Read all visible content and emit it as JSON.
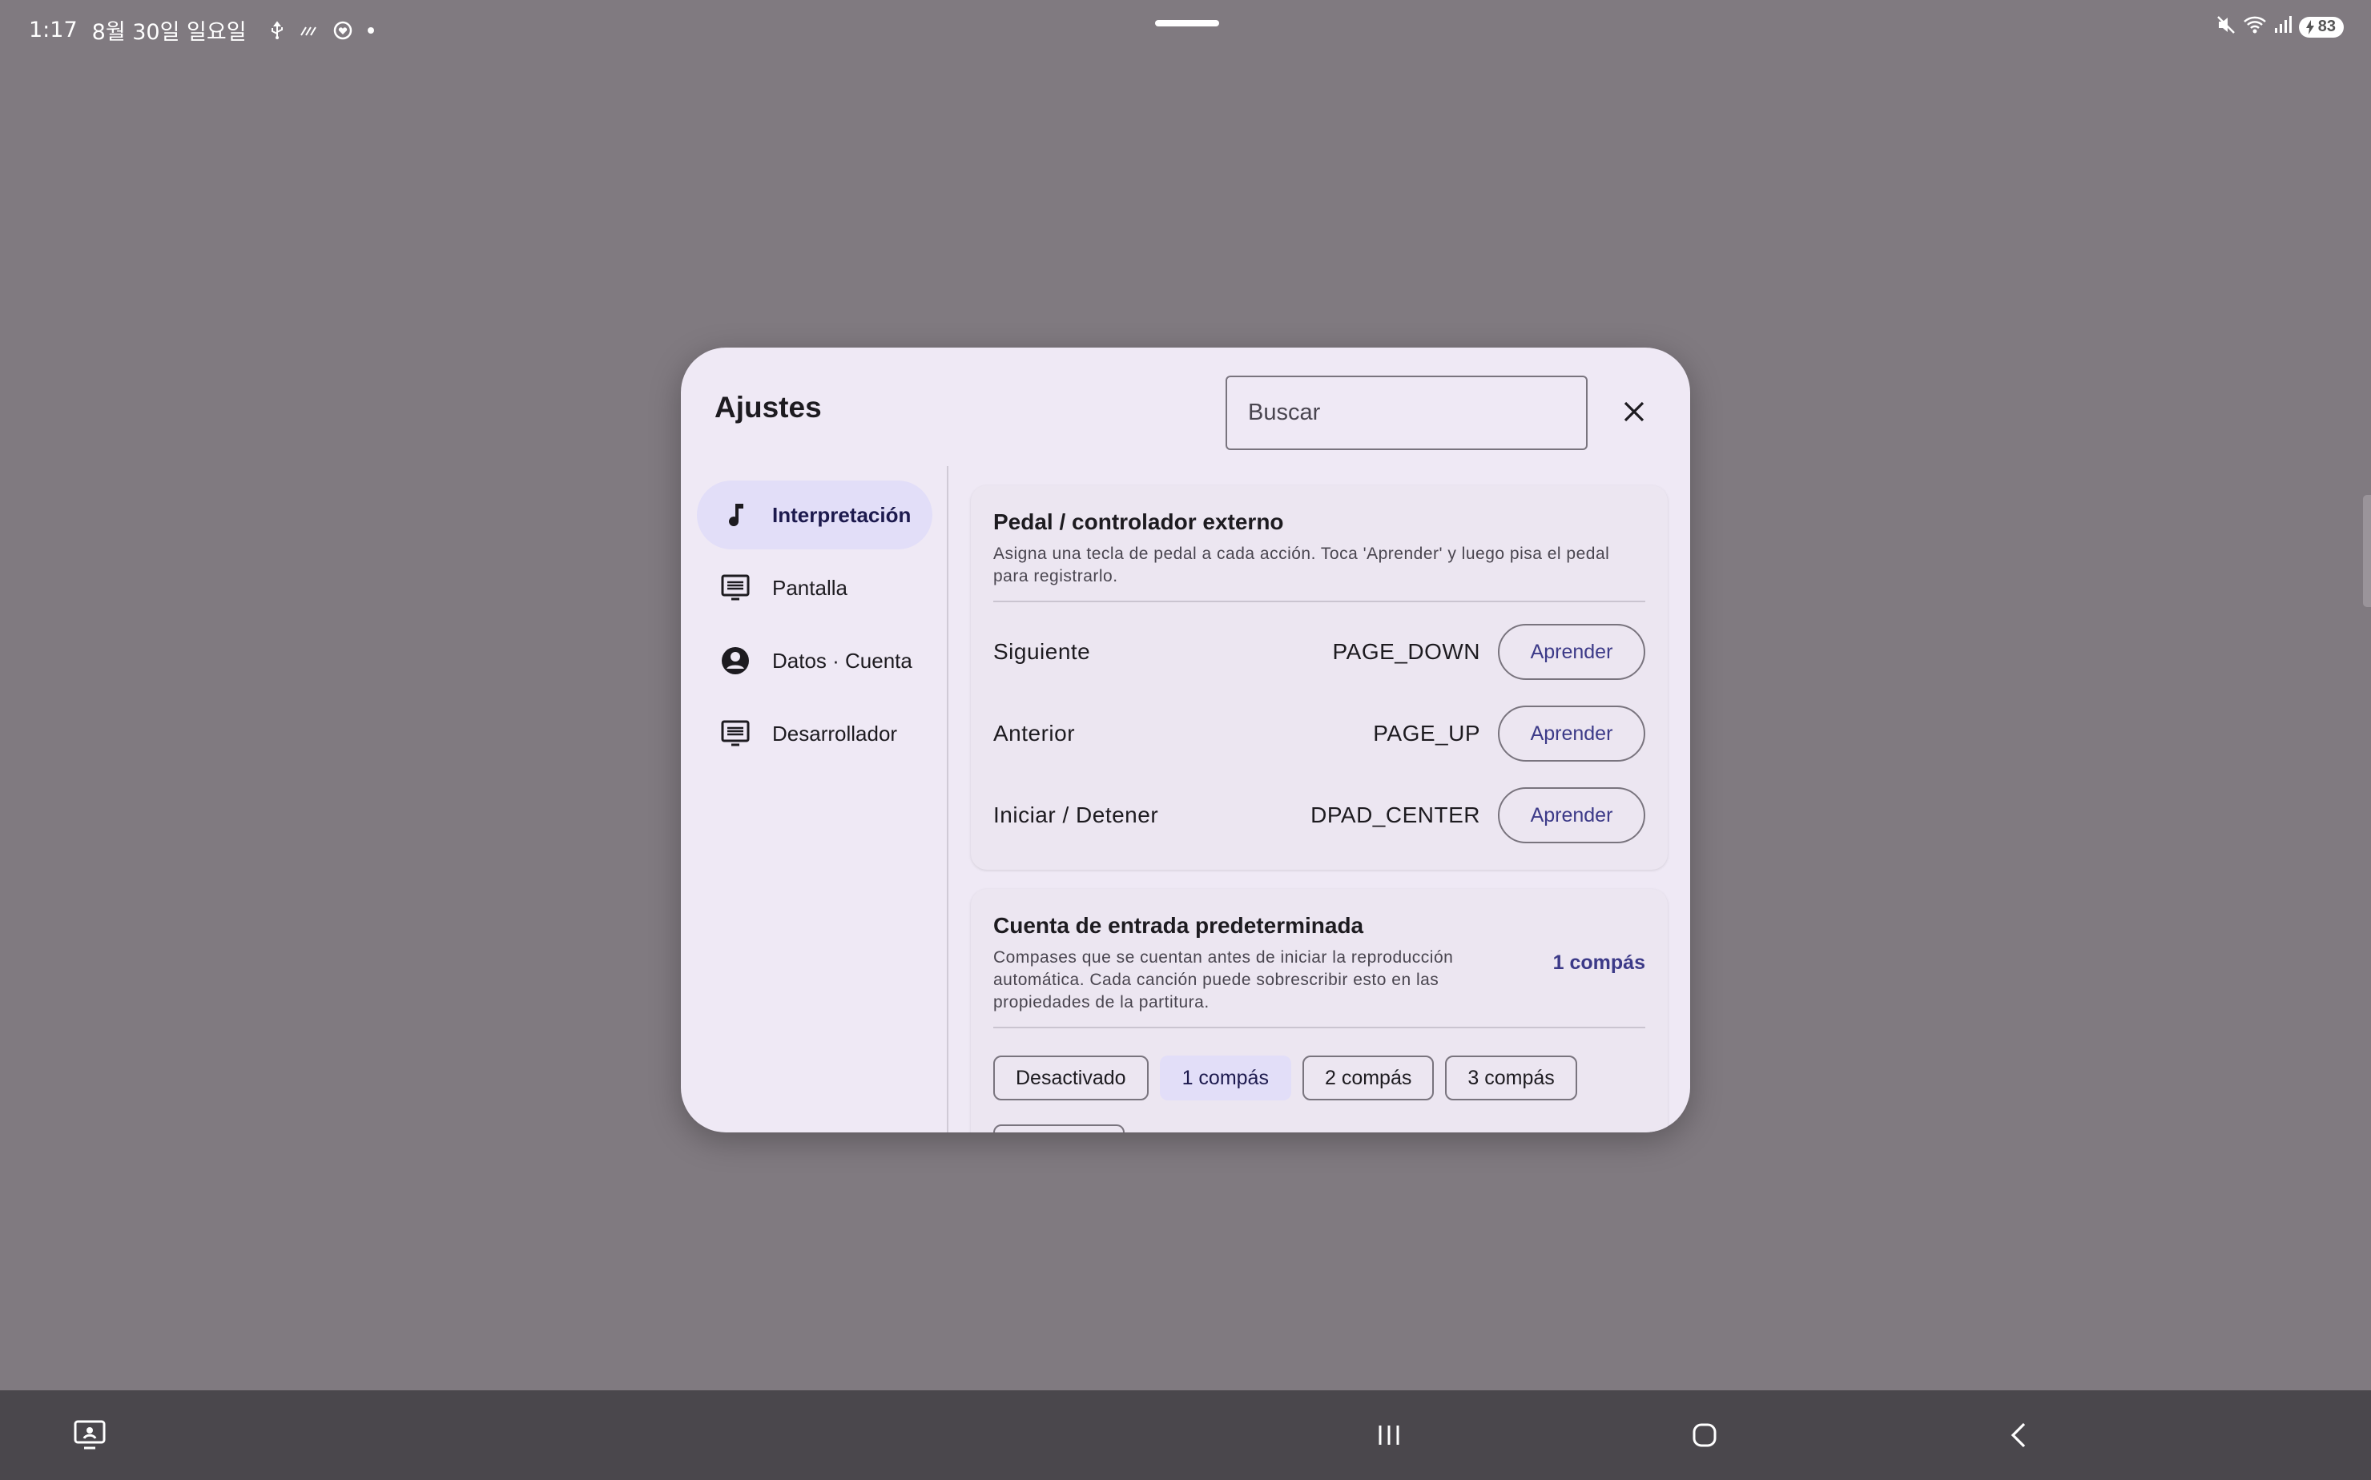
{
  "status_bar": {
    "time": "1:17",
    "date": "8월 30일 일요일",
    "battery": "83",
    "icons": [
      "usb-icon",
      "data-saver-icon",
      "shield-heart-icon",
      "dot-icon",
      "mute-icon",
      "wifi-icon",
      "signal-icon",
      "battery-icon"
    ]
  },
  "dialog": {
    "title": "Ajustes",
    "search_placeholder": "Buscar",
    "close_icon": "close-icon"
  },
  "nav": {
    "items": [
      {
        "label": "Interpretación",
        "icon": "music-note-icon",
        "active": true
      },
      {
        "label": "Pantalla",
        "icon": "display-settings-icon",
        "active": false
      },
      {
        "label": "Datos · Cuenta",
        "icon": "account-circle-icon",
        "active": false
      },
      {
        "label": "Desarrollador",
        "icon": "display-settings-icon",
        "active": false
      }
    ]
  },
  "pedal": {
    "title": "Pedal / controlador externo",
    "description": "Asigna una tecla de pedal a cada acción. Toca 'Aprender' y luego pisa el pedal para registrarlo.",
    "rows": [
      {
        "label": "Siguiente",
        "value": "PAGE_DOWN",
        "button": "Aprender"
      },
      {
        "label": "Anterior",
        "value": "PAGE_UP",
        "button": "Aprender"
      },
      {
        "label": "Iniciar / Detener",
        "value": "DPAD_CENTER",
        "button": "Aprender"
      }
    ]
  },
  "count_in": {
    "title": "Cuenta de entrada predeterminada",
    "description": "Compases que se cuentan antes de iniciar la reproducción automática. Cada canción puede sobrescribir esto en las propiedades de la partitura.",
    "value": "1 compás",
    "options": [
      {
        "label": "Desactivado",
        "selected": false
      },
      {
        "label": "1 compás",
        "selected": true
      },
      {
        "label": "2 compás",
        "selected": false
      },
      {
        "label": "3 compás",
        "selected": false
      }
    ]
  },
  "nav_bar": {
    "icons": [
      "screenshot-icon",
      "recent-apps-icon",
      "home-icon",
      "back-icon"
    ]
  },
  "colors": {
    "background": "#807a80",
    "dialog": "#efe9f5",
    "accent": "#3c3a88",
    "nav_active": "#e2def8",
    "nav_bar": "#4a474c"
  }
}
